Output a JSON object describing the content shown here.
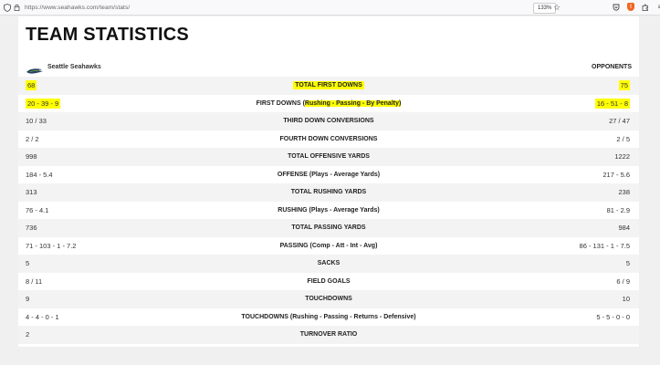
{
  "browser": {
    "url": "https://www.seahawks.com/team/stats/",
    "zoom": "133%"
  },
  "page": {
    "title": "TEAM STATISTICS",
    "team_name": "Seattle Seahawks",
    "opponents_label": "OPPONENTS"
  },
  "rows": [
    {
      "left": "68",
      "label": "TOTAL FIRST DOWNS",
      "right": "75"
    },
    {
      "left": "20 - 39 - 9",
      "label": "FIRST DOWNS (Rushing - Passing - By Penalty)",
      "right": "16 - 51 - 8"
    },
    {
      "left": "10 / 33",
      "label": "THIRD DOWN CONVERSIONS",
      "right": "27 / 47"
    },
    {
      "left": "2 / 2",
      "label": "FOURTH DOWN CONVERSIONS",
      "right": "2 / 5"
    },
    {
      "left": "998",
      "label": "TOTAL OFFENSIVE YARDS",
      "right": "1222"
    },
    {
      "left": "184 - 5.4",
      "label": "OFFENSE (Plays - Average Yards)",
      "right": "217 - 5.6"
    },
    {
      "left": "313",
      "label": "TOTAL RUSHING YARDS",
      "right": "238"
    },
    {
      "left": "76 - 4.1",
      "label": "RUSHING (Plays - Average Yards)",
      "right": "81 - 2.9"
    },
    {
      "left": "736",
      "label": "TOTAL PASSING YARDS",
      "right": "984"
    },
    {
      "left": "71 - 103 - 1 - 7.2",
      "label": "PASSING (Comp - Att - Int - Avg)",
      "right": "86 - 131 - 1 - 7.5"
    },
    {
      "left": "5",
      "label": "SACKS",
      "right": "5"
    },
    {
      "left": "8 / 11",
      "label": "FIELD GOALS",
      "right": "6 / 9"
    },
    {
      "left": "9",
      "label": "TOUCHDOWNS",
      "right": "10"
    },
    {
      "left": "4 - 4 - 0 - 1",
      "label": "TOUCHDOWNS (Rushing - Passing - Returns - Defensive)",
      "right": "5 - 5 - 0 - 0"
    },
    {
      "left": "2",
      "label": "TURNOVER RATIO",
      "right": ""
    }
  ],
  "first_downs_label_parts": {
    "pre": "FIRST DOWNS (",
    "highlighted": "Rushing - Passing - By Penalty)"
  },
  "colors": {
    "highlight": "#ffff00",
    "row_shade": "#f3f3f3"
  }
}
